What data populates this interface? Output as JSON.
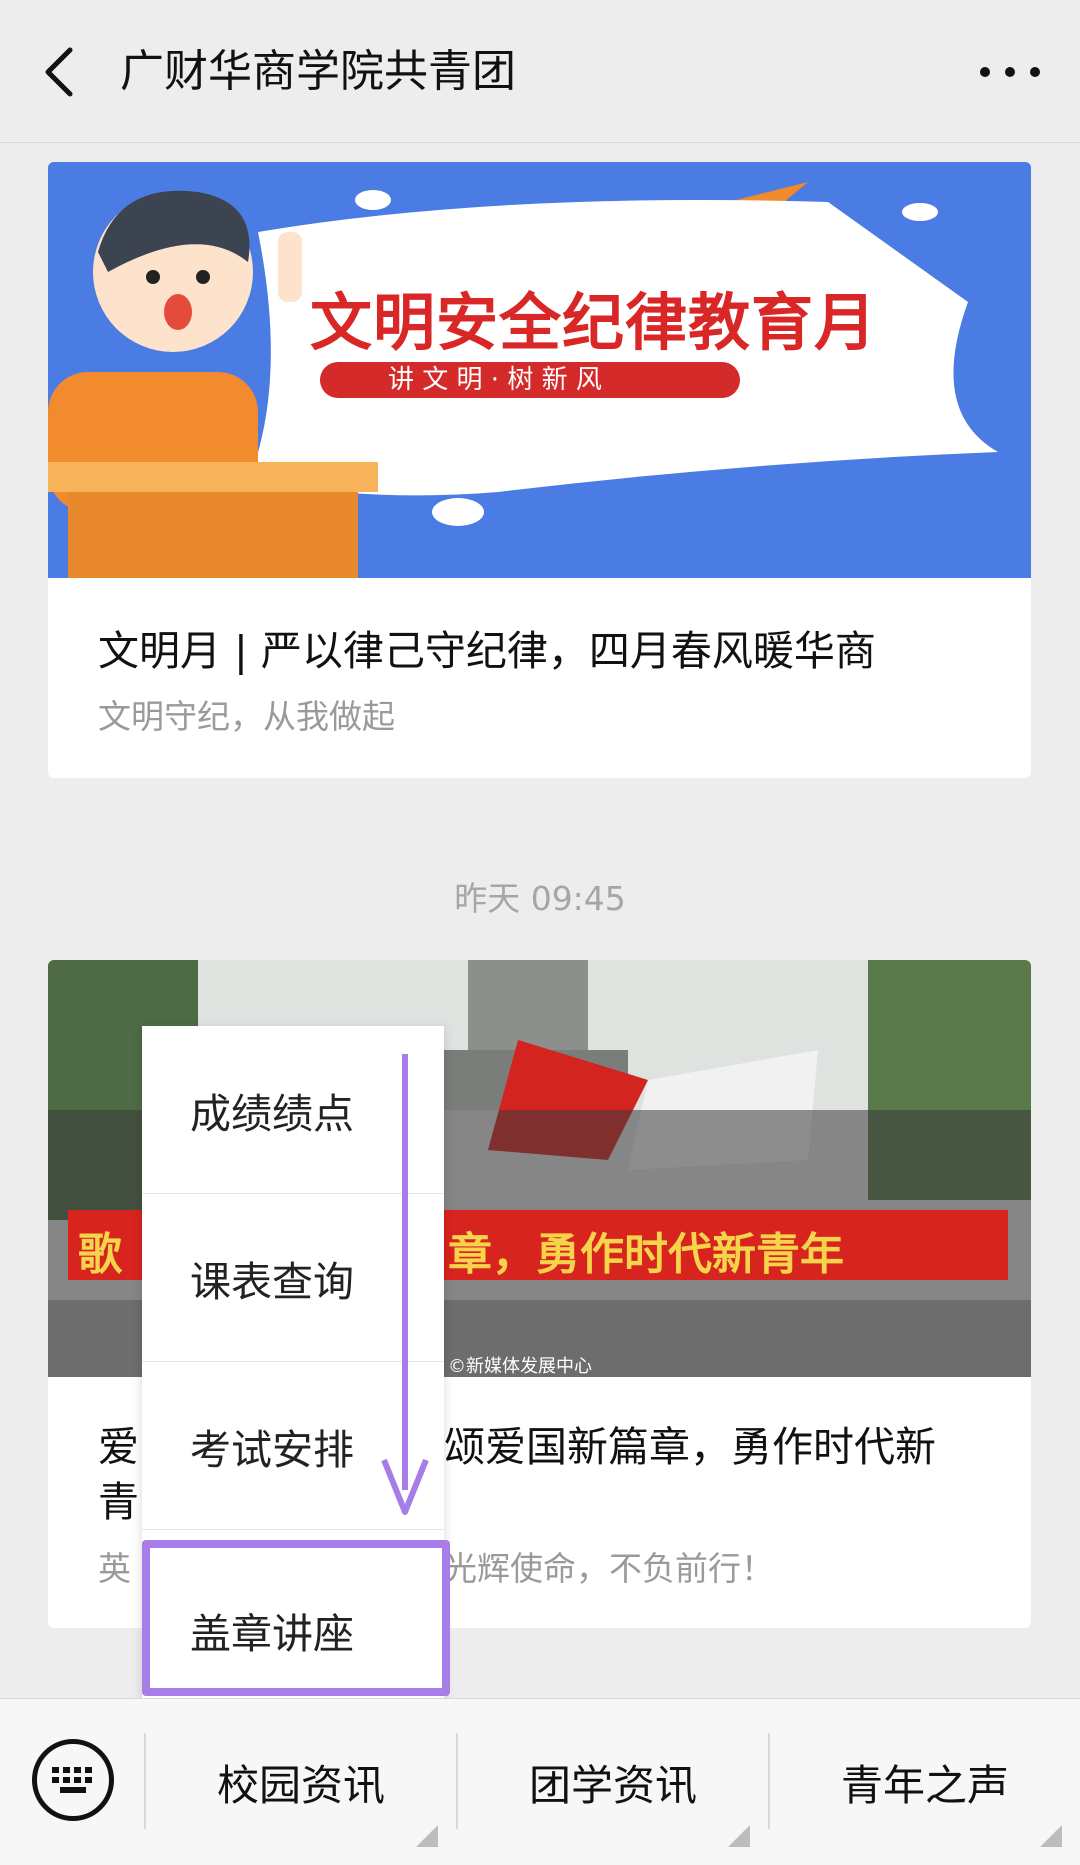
{
  "header": {
    "title": "广财华商学院共青团"
  },
  "card1": {
    "banner_title": "文明安全纪律教育月",
    "banner_slogan": "讲 文 明 · 树 新 风",
    "title": "文明月 | 严以律己守纪律，四月春风暖华商",
    "subtitle": "文明守纪，从我做起"
  },
  "timestamp": "昨天 09:45",
  "card2": {
    "photo_banner_text": "章，勇作时代新青年",
    "photo_banner_left": "歌",
    "photo_watermark": "©新媒体发展中心",
    "title_left": "爱",
    "title_left2": "青",
    "title_right": "颂爱国新篇章，勇作时代新",
    "subtitle_left": "英",
    "subtitle_right": "光辉使命，不负前行！"
  },
  "popup_menu": {
    "items": [
      "成绩绩点",
      "课表查询",
      "考试安排",
      "盖章讲座"
    ],
    "highlighted_index": 3,
    "highlight_color": "#a77ee8"
  },
  "bottom_menu": {
    "items": [
      "校园资讯",
      "团学资讯",
      "青年之声"
    ]
  }
}
